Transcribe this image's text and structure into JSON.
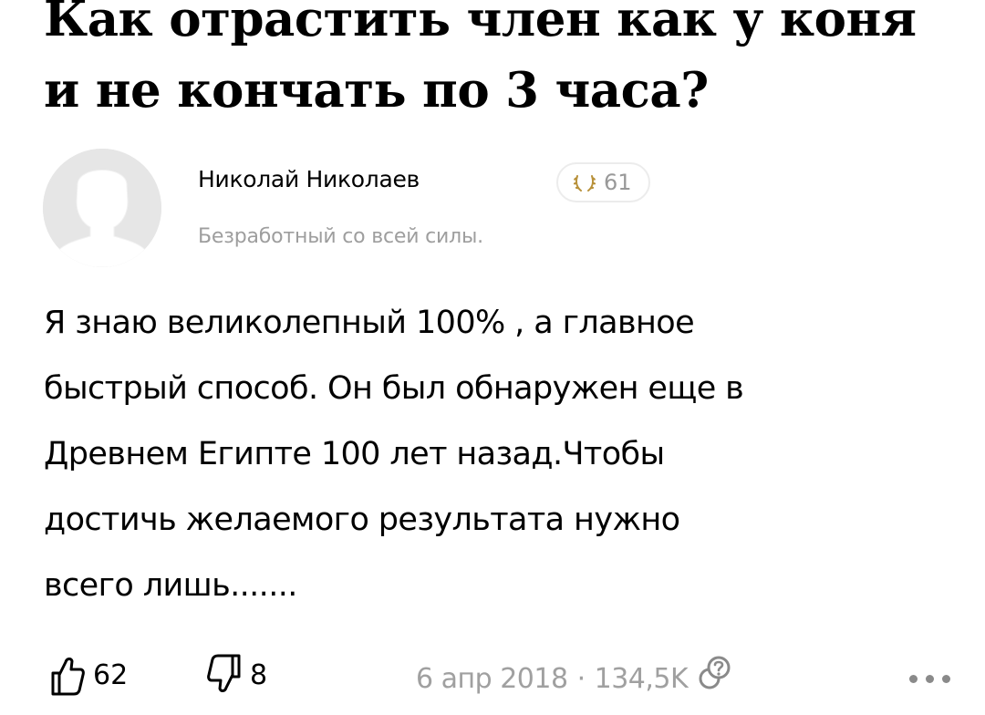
{
  "question": {
    "title": "Как отрастить член как у коня и не кончать по 3 часа?"
  },
  "author": {
    "name": "Николай Николаев",
    "bio": "Безработный со всей силы.",
    "rating": "61",
    "rating_icon": "laurel-wreath-icon",
    "avatar_icon": "default-user-silhouette-icon"
  },
  "answer": {
    "text": "Я знаю великолепный 100% , а главное\nбыстрый способ. Он  был обнаружен еще в\nДревнем Египте 100 лет назад.Чтобы\nдостичь желаемого результата нужно\nвсего лишь......."
  },
  "actions": {
    "upvotes": "62",
    "downvotes": "8",
    "date": "6 апр 2018",
    "separator": "·",
    "views": "134,5K",
    "icons": [
      "thumbs-up-icon",
      "thumbs-down-icon",
      "views-question-icon",
      "more-icon"
    ]
  },
  "colors": {
    "text": "#000000",
    "muted": "#9e9e9e",
    "badge_border": "#ececec",
    "avatar_bg": "#e6e6e6"
  }
}
